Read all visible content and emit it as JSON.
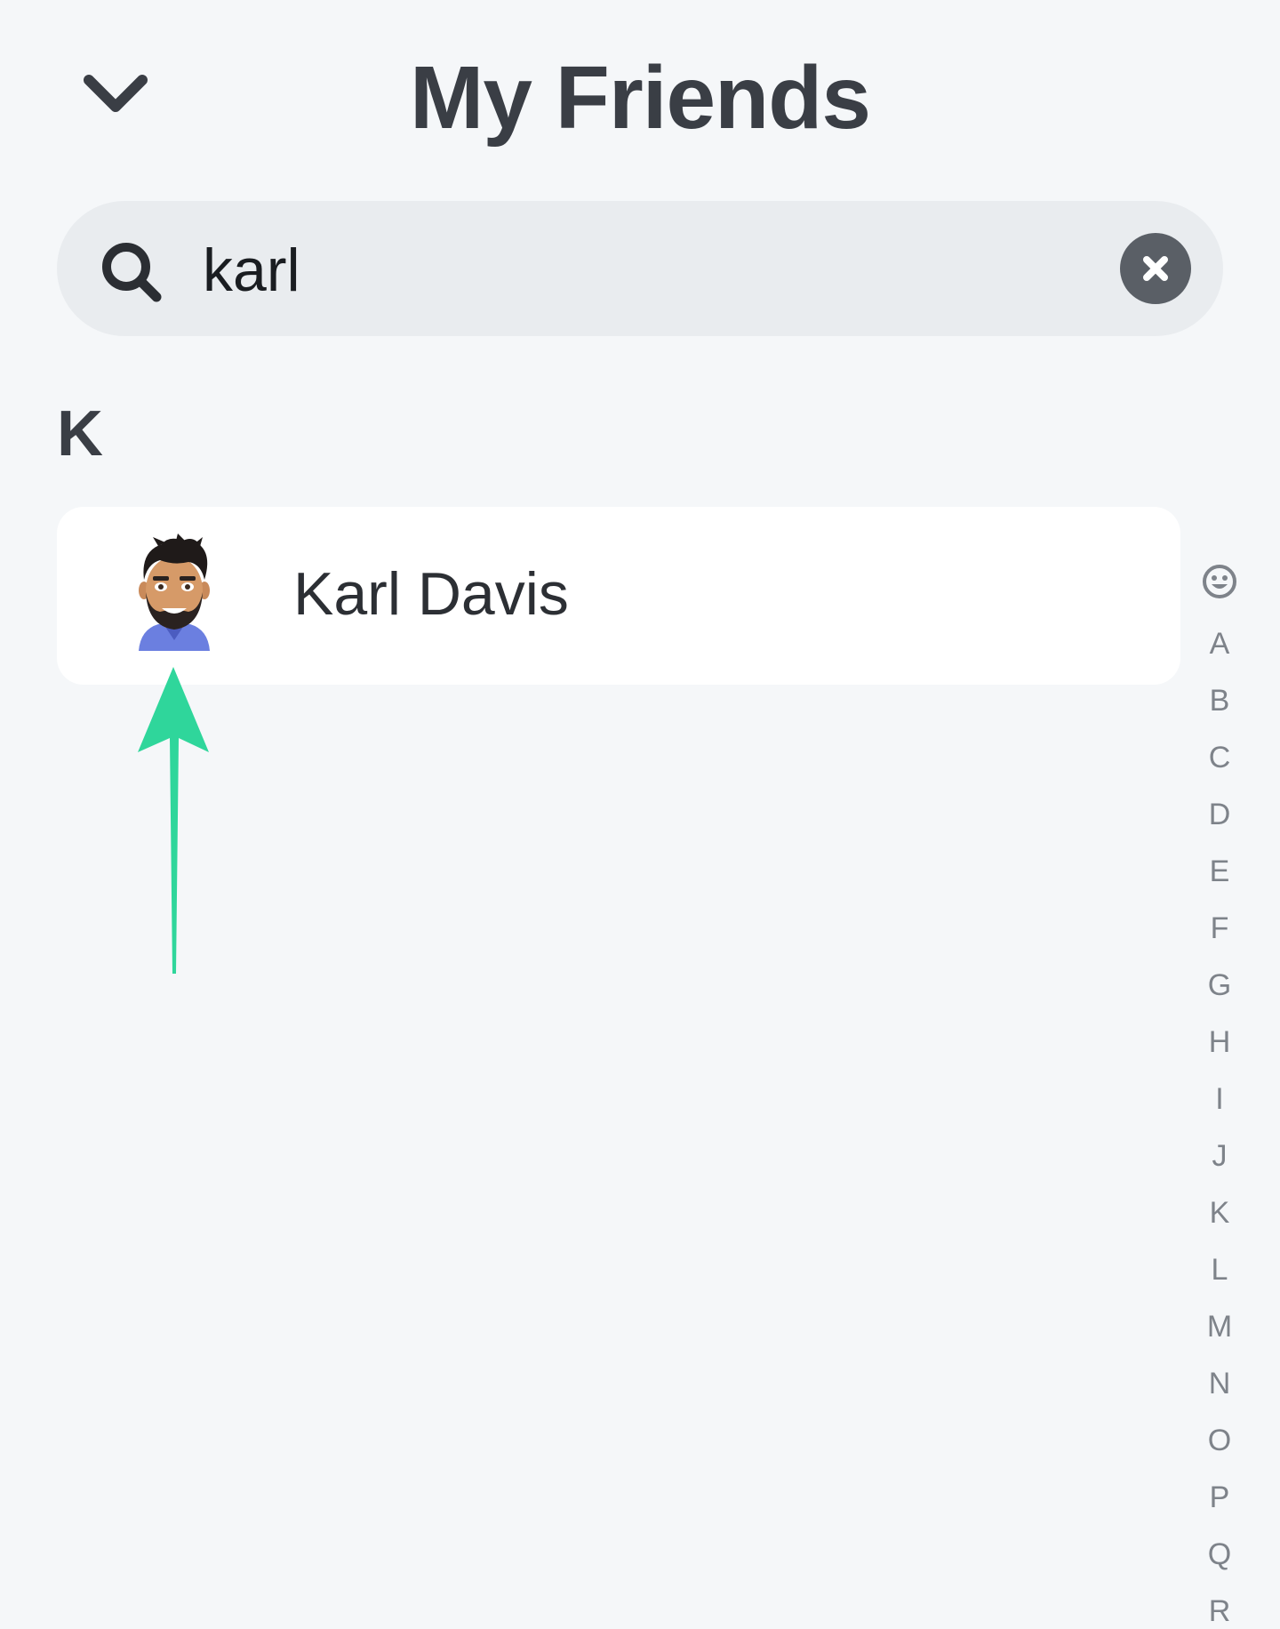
{
  "header": {
    "title": "My Friends",
    "back_icon": "chevron-down-icon"
  },
  "search": {
    "value": "karl",
    "icon": "search-icon",
    "clear_icon": "clear-icon"
  },
  "section": {
    "letter": "K"
  },
  "friends": [
    {
      "name": "Karl Davis",
      "avatar": "bitmoji-avatar"
    }
  ],
  "annotation": {
    "arrow_color": "#2fd69b"
  },
  "alpha_index": {
    "smiley_icon": "smiley-icon",
    "letters": [
      "A",
      "B",
      "C",
      "D",
      "E",
      "F",
      "G",
      "H",
      "I",
      "J",
      "K",
      "L",
      "M",
      "N",
      "O",
      "P",
      "Q",
      "R"
    ]
  },
  "colors": {
    "background": "#f5f7f9",
    "title": "#3a3e45",
    "search_bg": "#e9ecef",
    "index_text": "#7e838a",
    "accent_arrow": "#2fd69b"
  }
}
